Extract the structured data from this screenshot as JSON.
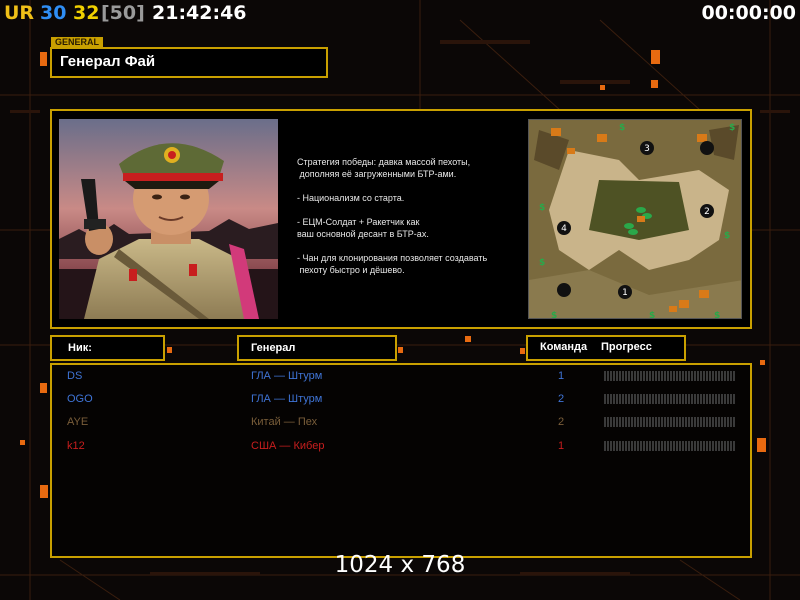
{
  "hud": {
    "ur": "UR",
    "stat_a": "30",
    "stat_b": "32",
    "stat_c": "[50]",
    "clock": "21:42:46",
    "timer": "00:00:00"
  },
  "general_panel": {
    "tag": "GENERAL",
    "name": "Генерал Фай"
  },
  "description": [
    "Стратегия победы: давка массой пехоты,",
    " дополняя её загруженными БТР-ами.",
    "",
    "- Национализм со старта.",
    "",
    "- ЕЦМ-Солдат + Ракетчик как",
    "ваш основной десант в БТР-ах.",
    "",
    "- Чан для клонирования позволяет создавать",
    " пехоту быстро и дёшево."
  ],
  "map": {
    "spawn_labels": [
      "3",
      "2",
      "4",
      "1"
    ],
    "money_symbol": "$"
  },
  "headers": {
    "nick": "Ник:",
    "general": "Генерал",
    "team": "Команда",
    "progress": "Прогресс"
  },
  "players": [
    {
      "nick": "DS",
      "general": "ГЛА — Штурм",
      "team": "1",
      "color": "#3f74d6",
      "progress": 0
    },
    {
      "nick": "OGO",
      "general": "ГЛА — Штурм",
      "team": "2",
      "color": "#3f74d6",
      "progress": 0
    },
    {
      "nick": "AYE",
      "general": "Китай — Пех",
      "team": "2",
      "color": "#7a5e3a",
      "progress": 0
    },
    {
      "nick": "k12",
      "general": "США — Кибер",
      "team": "1",
      "color": "#c81e1e",
      "progress": 0
    }
  ],
  "resolution_label": "1024 x 768",
  "colors": {
    "frame": "#c9a000",
    "accent_orange": "#e86a10"
  }
}
